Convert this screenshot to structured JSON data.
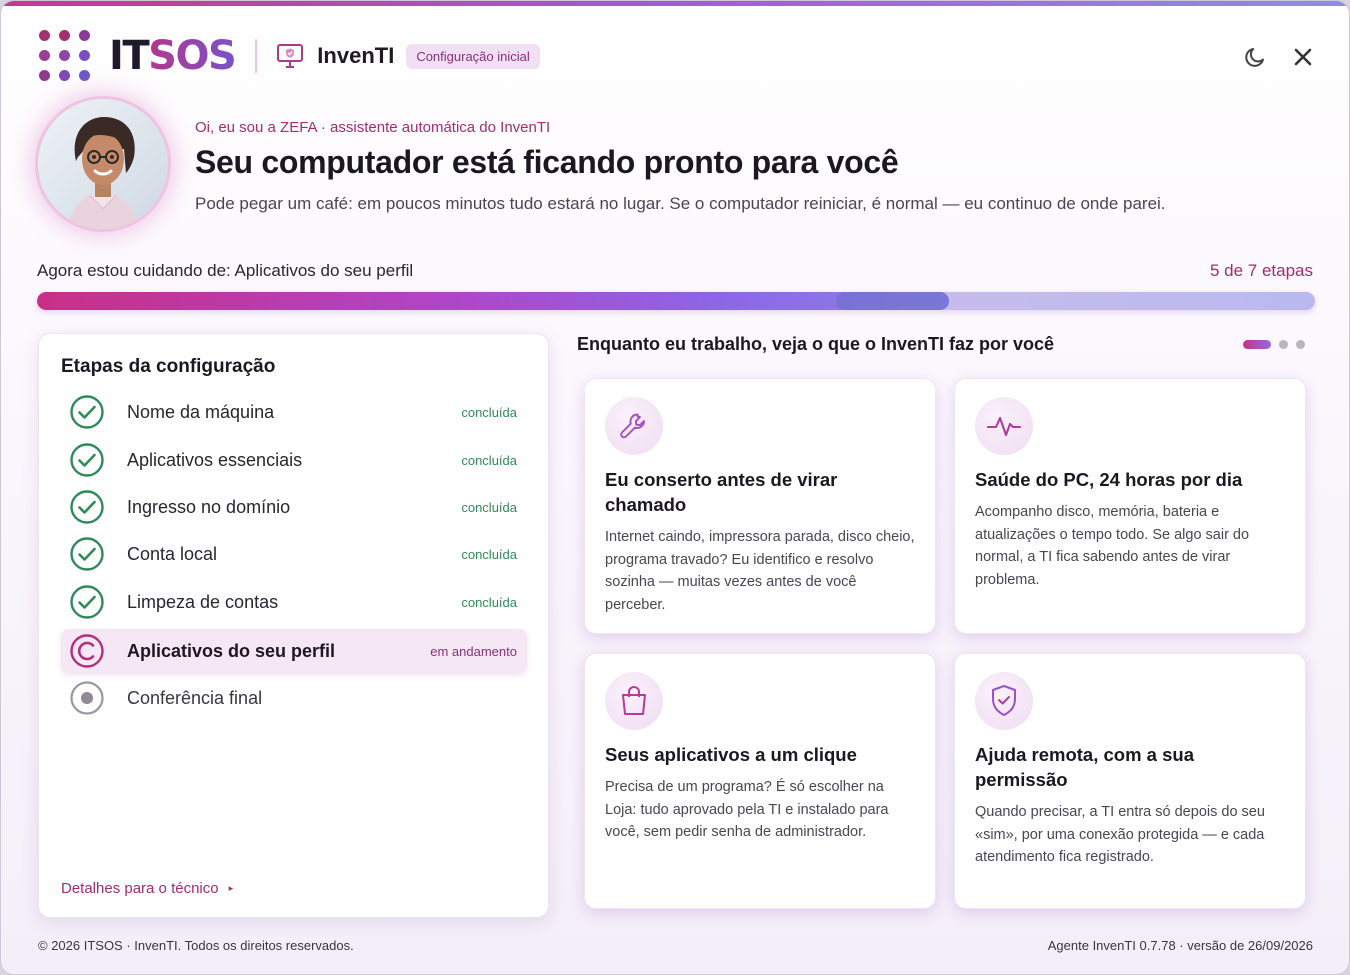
{
  "brand": {
    "part1": "IT",
    "part2": "SOS",
    "product": "InvenTI",
    "badge": "Configuração inicial"
  },
  "window_controls": {
    "theme_icon": "moon-icon",
    "close_icon": "close-icon"
  },
  "hero": {
    "kicker": "Oi, eu sou a ZEFA · assistente automática do InvenTI",
    "title": "Seu computador está ficando pronto para você",
    "subtitle": "Pode pegar um café: em poucos minutos tudo estará no lugar. Se o computador reiniciar, é normal — eu continuo de onde parei."
  },
  "progress": {
    "label": "Agora estou cuidando de: Aplicativos do seu perfil",
    "count": "5 de 7 etapas",
    "value": 0.714
  },
  "steps_panel": {
    "title": "Etapas da configuração",
    "steps": [
      {
        "label": "Nome da máquina",
        "status": "concluída",
        "state": "done"
      },
      {
        "label": "Aplicativos essenciais",
        "status": "concluída",
        "state": "done"
      },
      {
        "label": "Ingresso no domínio",
        "status": "concluída",
        "state": "done"
      },
      {
        "label": "Conta local",
        "status": "concluída",
        "state": "done"
      },
      {
        "label": "Limpeza de contas",
        "status": "concluída",
        "state": "done"
      },
      {
        "label": "Aplicativos do seu perfil",
        "status": "em andamento",
        "state": "active"
      },
      {
        "label": "Conferência final",
        "status": "",
        "state": "pending"
      }
    ],
    "details_link": "Detalhes para o técnico"
  },
  "features": {
    "title": "Enquanto eu trabalho, veja o que o InvenTI faz por você",
    "pager": {
      "pages": 3,
      "current": 1
    },
    "cards": [
      {
        "icon": "wrench-icon",
        "title": "Eu conserto antes de virar chamado",
        "text": "Internet caindo, impressora parada, disco cheio, programa travado? Eu identifico e resolvo sozinha — muitas vezes antes de você perceber."
      },
      {
        "icon": "pulse-icon",
        "title": "Saúde do PC, 24 horas por dia",
        "text": "Acompanho disco, memória, bateria e atualizações o tempo todo. Se algo sair do normal, a TI fica sabendo antes de virar problema."
      },
      {
        "icon": "shopping-bag-icon",
        "title": "Seus aplicativos a um clique",
        "text": "Precisa de um programa? É só escolher na Loja: tudo aprovado pela TI e instalado para você, sem pedir senha de administrador."
      },
      {
        "icon": "shield-check-icon",
        "title": "Ajuda remota, com a sua permissão",
        "text": "Quando precisar, a TI entra só depois do seu «sim», por uma conexão protegida — e cada atendimento fica registrado."
      }
    ]
  },
  "footer": {
    "copyright": "© 2026 ITSOS · InvenTI. Todos os direitos reservados.",
    "version": "Agente InvenTI 0.7.78 · versão de 26/09/2026"
  },
  "colors": {
    "accent": "#a12c72",
    "purple": "#a35ad8",
    "success": "#2f8a5a",
    "active_bg": "#f5e7f3"
  }
}
